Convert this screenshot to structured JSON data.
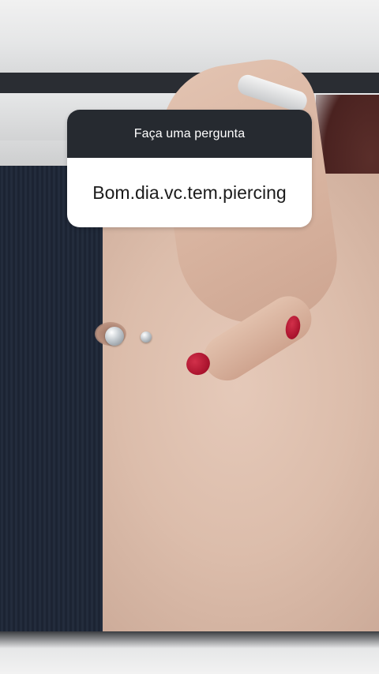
{
  "question_sticker": {
    "title": "Faça uma pergunta",
    "answer": "Bom.dia.vc.tem.piercing"
  },
  "colors": {
    "sticker_header": "#262a30",
    "sticker_body": "#ffffff",
    "nail_polish": "#a8122c",
    "pants": "#1c2433",
    "shirt": "#c5302a"
  }
}
